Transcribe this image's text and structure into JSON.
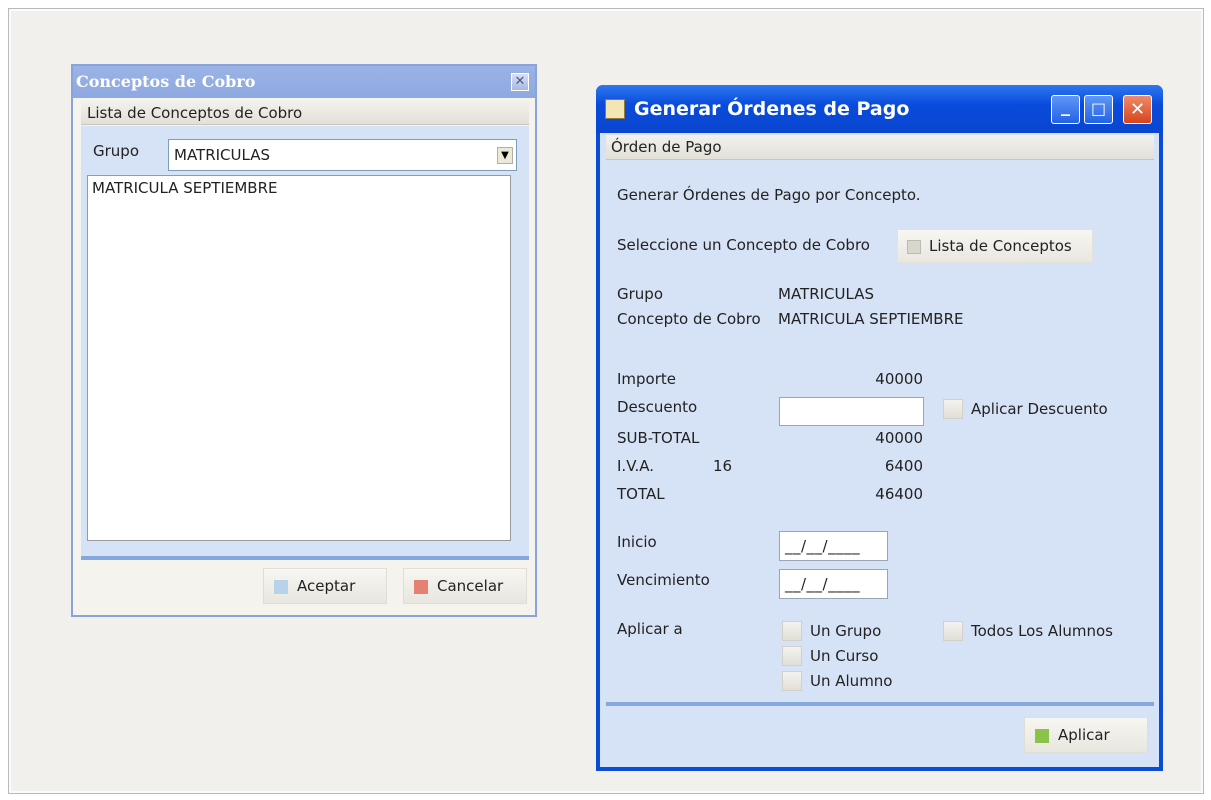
{
  "conceptos_dialog": {
    "title": "Conceptos de Cobro",
    "close_glyph": "✕",
    "section_title": "Lista de Conceptos de Cobro",
    "grupo_label": "Grupo",
    "grupo_selected": "MATRICULAS",
    "dropdown_glyph": "▼",
    "list_items": [
      "MATRICULA SEPTIEMBRE"
    ],
    "accept_label": "Aceptar",
    "cancel_label": "Cancelar",
    "accept_color": "#b7d3ea",
    "cancel_color": "#e58073"
  },
  "orden_dialog": {
    "title": "Generar Órdenes de Pago",
    "min_glyph": "_",
    "max_glyph": "□",
    "close_glyph": "✕",
    "section_title": "Órden de Pago",
    "intro_text": "Generar Órdenes de Pago por Concepto.",
    "select_prompt": "Seleccione un Concepto de Cobro",
    "lista_button_label": "Lista de Conceptos",
    "grupo_label": "Grupo",
    "grupo_value": "MATRICULAS",
    "concepto_label": "Concepto de Cobro",
    "concepto_value": "MATRICULA SEPTIEMBRE",
    "importe_label": "Importe",
    "importe_value": "40000",
    "descuento_label": "Descuento",
    "descuento_value": "",
    "aplicar_descuento_label": "Aplicar Descuento",
    "subtotal_label": "SUB-TOTAL",
    "subtotal_value": "40000",
    "iva_label": "I.V.A.",
    "iva_rate": "16",
    "iva_value": "6400",
    "total_label": "TOTAL",
    "total_value": "46400",
    "inicio_label": "Inicio",
    "inicio_value": "__/__/____",
    "vencimiento_label": "Vencimiento",
    "vencimiento_value": "__/__/____",
    "aplicar_a_label": "Aplicar a",
    "options": {
      "un_grupo": "Un Grupo",
      "un_curso": "Un Curso",
      "un_alumno": "Un Alumno",
      "todos": "Todos Los Alumnos"
    },
    "apply_button_label": "Aplicar",
    "apply_color": "#8bc34a",
    "title_bar_color": "#0a4bdc"
  }
}
